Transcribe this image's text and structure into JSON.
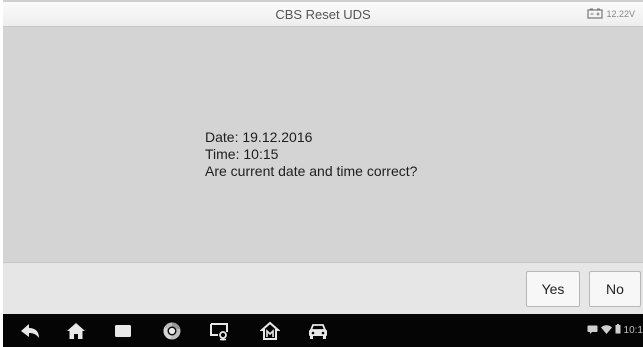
{
  "header": {
    "title": "CBS Reset UDS",
    "voltage": "12.22V"
  },
  "dialog": {
    "date_line": "Date: 19.12.2016",
    "time_line": "Time: 10:15",
    "question": "Are current date and time correct?"
  },
  "actions": {
    "yes_label": "Yes",
    "no_label": "No"
  },
  "navbar": {
    "icons": [
      "back-icon",
      "home-icon",
      "recent-apps-icon",
      "chrome-icon",
      "remote-desk-icon",
      "service-home-icon",
      "vehicle-icon"
    ]
  },
  "status_bar": {
    "icons": [
      "message-icon",
      "wifi-icon",
      "battery-icon"
    ],
    "time": "10:1"
  }
}
